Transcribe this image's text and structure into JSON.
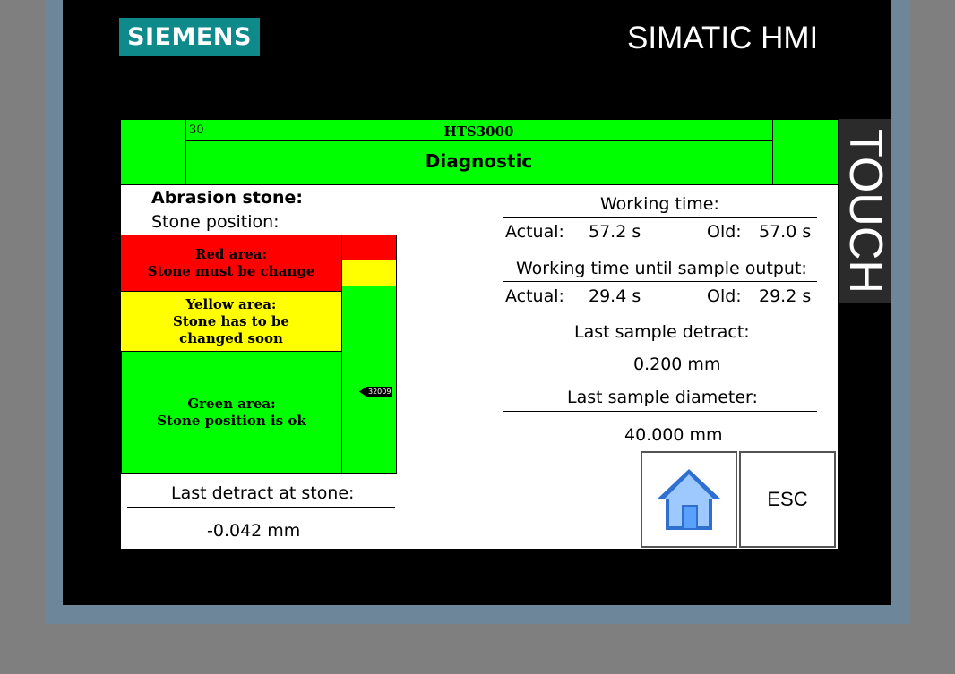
{
  "brand": {
    "logo": "SIEMENS",
    "product": "SIMATIC HMI",
    "touch": "TOUCH"
  },
  "header": {
    "screen_number": "30",
    "model": "HTS3000",
    "title": "Diagnostic"
  },
  "stone": {
    "heading": "Abrasion stone:",
    "position_label": "Stone position:",
    "red": {
      "title": "Red area:",
      "desc": "Stone must be change",
      "color": "#ff0000"
    },
    "yellow": {
      "title": "Yellow area:",
      "line1": "Stone has to be",
      "line2": "changed soon",
      "color": "#ffff00"
    },
    "green": {
      "title": "Green area:",
      "desc": "Stone position is ok",
      "color": "#00ff00"
    },
    "pointer_value": "32009",
    "last_detract_label": "Last detract at stone:",
    "last_detract_value": "-0.042 mm"
  },
  "working_time": {
    "label": "Working time:",
    "actual_label": "Actual:",
    "actual_value": "57.2 s",
    "old_label": "Old:",
    "old_value": "57.0 s"
  },
  "sample_output": {
    "label": "Working time until sample output:",
    "actual_label": "Actual:",
    "actual_value": "29.4 s",
    "old_label": "Old:",
    "old_value": "29.2 s"
  },
  "sample_detract": {
    "label": "Last sample detract:",
    "value": "0.200 mm"
  },
  "sample_diameter": {
    "label": "Last sample diameter:",
    "value": "40.000 mm"
  },
  "buttons": {
    "home_icon": "home-icon",
    "esc": "ESC"
  }
}
